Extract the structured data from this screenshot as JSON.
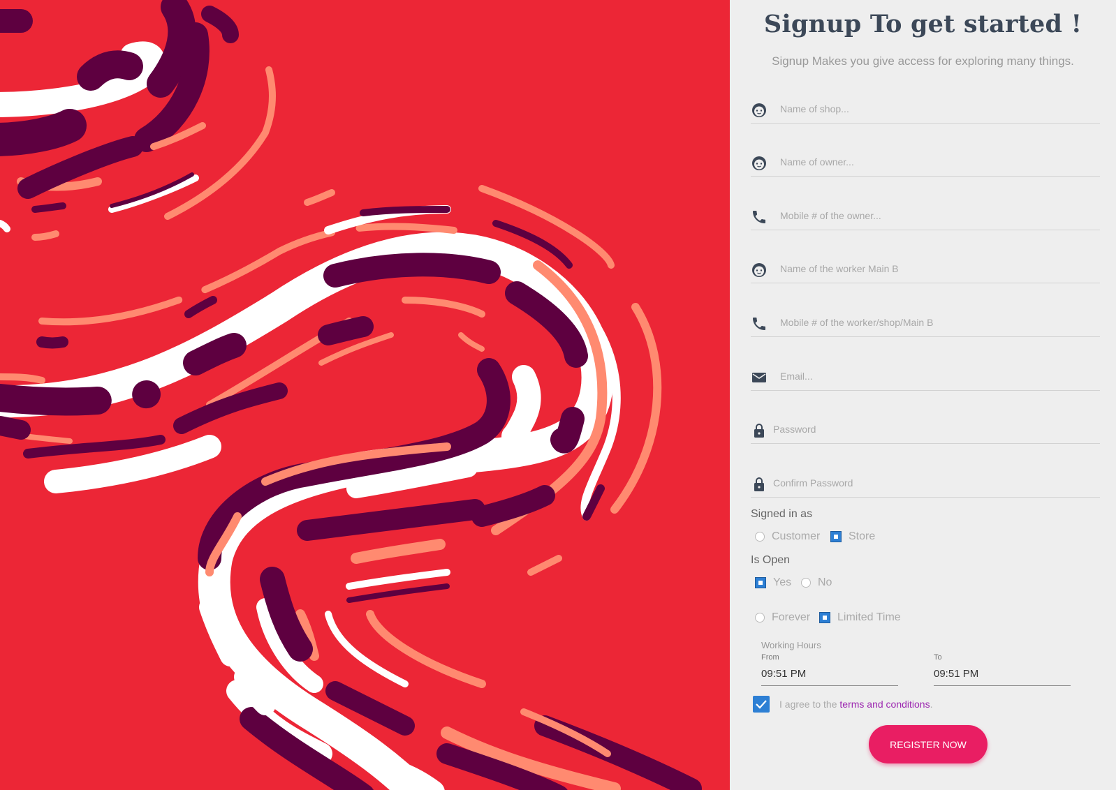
{
  "header": {
    "title": "Signup To get started !",
    "subtitle": "Signup Makes you give access for exploring many things."
  },
  "fields": {
    "shop_name": {
      "placeholder": "Name of shop...",
      "icon": "face-icon"
    },
    "owner_name": {
      "placeholder": "Name of owner...",
      "icon": "face-icon"
    },
    "owner_mobile": {
      "placeholder": "Mobile # of the owner...",
      "icon": "phone-icon"
    },
    "worker_name": {
      "placeholder": "Name of the worker Main B",
      "icon": "face-icon"
    },
    "worker_mobile": {
      "placeholder": "Mobile # of the worker/shop/Main B",
      "icon": "phone-icon"
    },
    "email": {
      "placeholder": "Email...",
      "icon": "mail-icon"
    },
    "password": {
      "placeholder": "Password",
      "icon": "lock-icon"
    },
    "confirm_password": {
      "placeholder": "Confirm Password",
      "icon": "lock-icon"
    }
  },
  "signed_in_as": {
    "label": "Signed in as",
    "options": [
      "Customer",
      "Store"
    ],
    "selected": "Store"
  },
  "is_open": {
    "label": "Is Open",
    "options": [
      "Yes",
      "No"
    ],
    "selected": "Yes"
  },
  "duration": {
    "options": [
      "Forever",
      "Limited Time"
    ],
    "selected": "Limited Time"
  },
  "working_hours": {
    "label": "Working Hours",
    "from_label": "From",
    "from_value": "09:51 PM",
    "to_label": "To",
    "to_value": "09:51 PM"
  },
  "agreement": {
    "checked": true,
    "prefix": "I agree to the ",
    "link": "terms and conditions",
    "suffix": "."
  },
  "register_button": "REGISTER NOW",
  "colors": {
    "art_background": "#ec2636",
    "art_dark": "#5e0040",
    "art_salmon": "#ff8a70",
    "panel_background": "#eeeeee",
    "title": "#3c4858",
    "button": "#e91e63",
    "link": "#9c27b0",
    "checkbox": "#2d7fd4"
  }
}
